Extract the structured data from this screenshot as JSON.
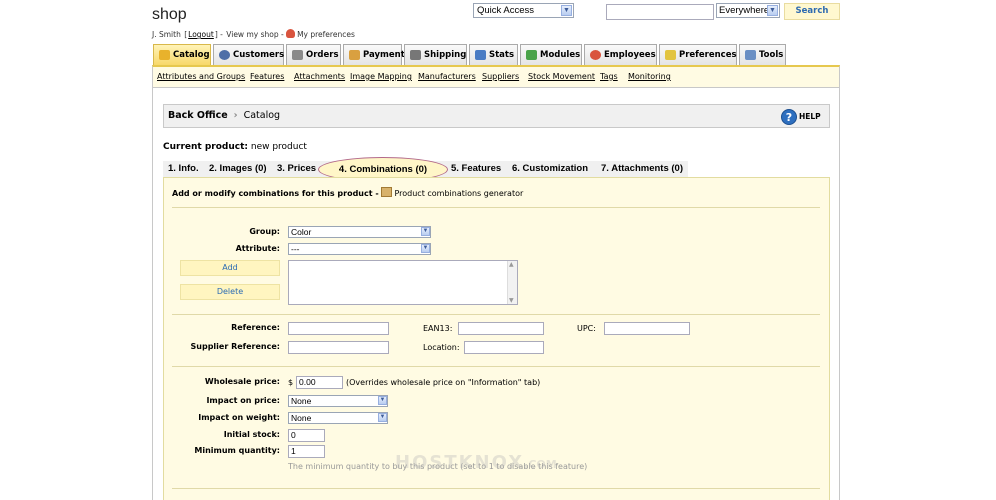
{
  "header": {
    "shop_title": "shop",
    "user_name": "J. Smith",
    "logout": "Logout",
    "view_shop": "View my shop",
    "my_preferences": "My preferences",
    "quick_access": "Quick Access",
    "search_scope": "Everywhere",
    "search_button": "Search"
  },
  "main_tabs": [
    "Catalog",
    "Customers",
    "Orders",
    "Payment",
    "Shipping",
    "Stats",
    "Modules",
    "Employees",
    "Preferences",
    "Tools"
  ],
  "sub_tabs": [
    "Attributes and Groups",
    "Features",
    "Attachments",
    "Image Mapping",
    "Manufacturers",
    "Suppliers",
    "Stock Movement",
    "Tags",
    "Monitoring"
  ],
  "breadcrumb": {
    "root": "Back Office",
    "current": "Catalog",
    "help": "HELP"
  },
  "current_product": {
    "label": "Current product:",
    "value": "new product"
  },
  "product_tabs": [
    "1. Info.",
    "2. Images (0)",
    "3. Prices",
    "4. Combinations (0)",
    "5. Features",
    "6. Customization",
    "7. Attachments (0)"
  ],
  "panel": {
    "title": "Add or modify combinations for this product -",
    "generator_link": "Product combinations generator",
    "group_label": "Group:",
    "group_value": "Color",
    "attribute_label": "Attribute:",
    "attribute_value": "---",
    "add_button": "Add",
    "delete_button": "Delete",
    "reference_label": "Reference:",
    "ean13_label": "EAN13:",
    "upc_label": "UPC:",
    "supplier_reference_label": "Supplier Reference:",
    "location_label": "Location:",
    "wholesale_label": "Wholesale price:",
    "currency": "$",
    "wholesale_value": "0.00",
    "wholesale_note": "(Overrides wholesale price on \"Information\" tab)",
    "impact_price_label": "Impact on price:",
    "impact_price_value": "None",
    "impact_weight_label": "Impact on weight:",
    "impact_weight_value": "None",
    "initial_stock_label": "Initial stock:",
    "initial_stock_value": "0",
    "min_qty_label": "Minimum quantity:",
    "min_qty_value": "1",
    "min_qty_hint": "The minimum quantity to buy this product (set to 1 to disable this feature)"
  },
  "watermark": {
    "brand": "HOSTKNOX",
    "suffix": ".COM"
  },
  "colors": {
    "accent_yellow": "#f7d86a",
    "panel_bg": "#fffbe3",
    "link_blue": "#2a6bb4"
  }
}
